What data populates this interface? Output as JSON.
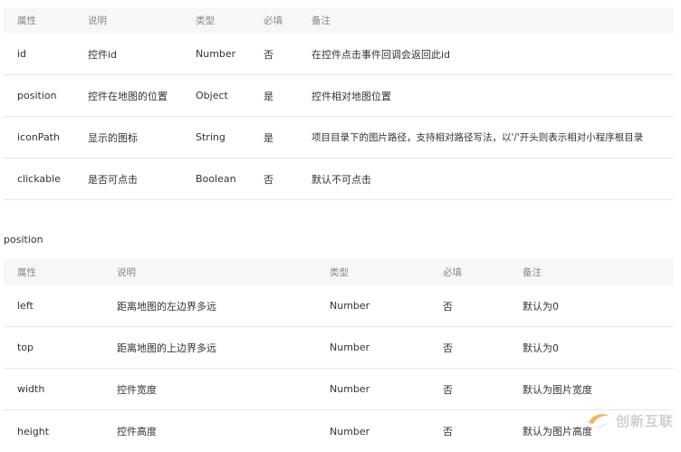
{
  "controls_table": {
    "headers": [
      "属性",
      "说明",
      "类型",
      "必填",
      "备注"
    ],
    "rows": [
      [
        "id",
        "控件id",
        "Number",
        "否",
        "在控件点击事件回调会返回此id"
      ],
      [
        "position",
        "控件在地图的位置",
        "Object",
        "是",
        "控件相对地图位置"
      ],
      [
        "iconPath",
        "显示的图标",
        "String",
        "是",
        "项目目录下的图片路径，支持相对路径写法，以'/'开头则表示相对小程序根目录"
      ],
      [
        "clickable",
        "是否可点击",
        "Boolean",
        "否",
        "默认不可点击"
      ]
    ]
  },
  "section_title": "position",
  "position_table": {
    "headers": [
      "属性",
      "说明",
      "类型",
      "必填",
      "备注"
    ],
    "rows": [
      [
        "left",
        "距离地图的左边界多远",
        "Number",
        "否",
        "默认为0"
      ],
      [
        "top",
        "距离地图的上边界多远",
        "Number",
        "否",
        "默认为0"
      ],
      [
        "width",
        "控件宽度",
        "Number",
        "否",
        "默认为图片宽度"
      ],
      [
        "height",
        "控件高度",
        "Number",
        "否",
        "默认为图片高度"
      ]
    ]
  },
  "watermark": {
    "text": "创新互联",
    "color": "#c8c8c8",
    "accent": "#f4a640"
  }
}
